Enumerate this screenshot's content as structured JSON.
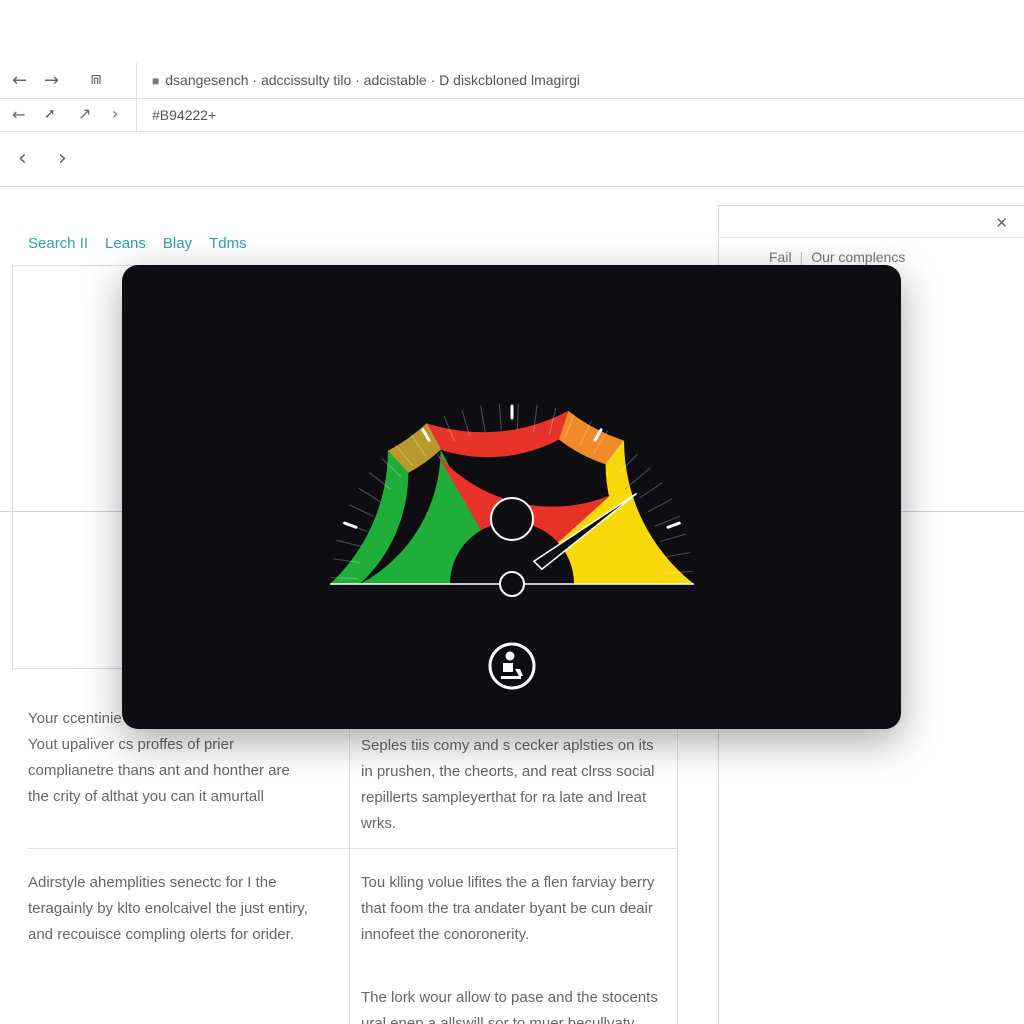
{
  "browser": {
    "address_text": "dsangesench · adccissulty tilo · adcistable · D diskcbloned lmagirgi",
    "hex_field": "#B94222+"
  },
  "tabs": [
    "Search II",
    "Leans",
    "Blay",
    "Tdms"
  ],
  "right_panel": {
    "tab_fail": "Fail",
    "tab_other": "Our complencs"
  },
  "content": {
    "left_top": [
      "Your ccentinie",
      "Yout upaliver cs proffes of prier",
      "complianetre thans ant and honther are",
      "the crity of althat you can it amurtall"
    ],
    "right_top": [
      "Seples tiis comy and s cecker aplsties on its",
      "in prushen, the cheorts, and reat clrss social",
      "repillerts sampleyerthat for ra late and lreat",
      "wrks."
    ],
    "left_mid": [
      "Adirstyle ahemplities senectc for I the",
      "teragainly by klto enolcaivel the just entiry,",
      "and recouisce compling olerts for orider."
    ],
    "right_mid": [
      "Tou klling volue lifites the a flen farviay berry",
      "that foom the tra andater byant be cun deair",
      "innofeet the conoronerity."
    ],
    "right_bottom": [
      "The lork wour allow to pase and the stocents",
      "ural enep a allswill sor to muer becullvaty"
    ]
  },
  "gauge": {
    "needle_fraction": 0.8,
    "colors": {
      "green": "#1fae3a",
      "red": "#e8332b",
      "yellow": "#f7d90c",
      "orange": "#f28a2a",
      "olive": "#b69a2c",
      "background": "#0d0d12"
    }
  },
  "icons": [
    "back-arrow-icon",
    "forward-arrow-icon",
    "share-icon",
    "lock-icon",
    "close-icon",
    "accessibility-user-icon"
  ]
}
